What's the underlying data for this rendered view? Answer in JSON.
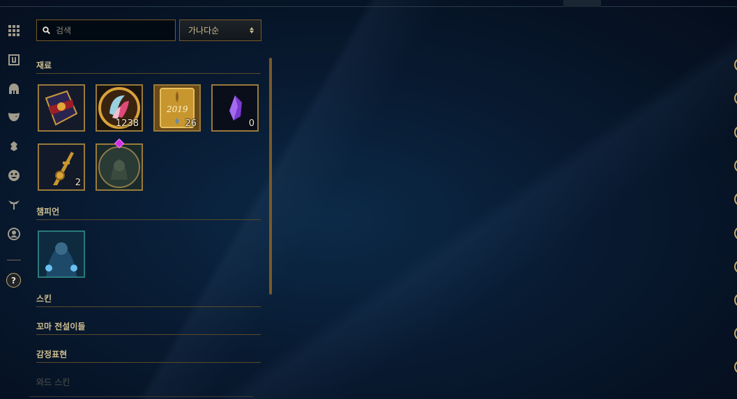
{
  "search": {
    "placeholder": "검색"
  },
  "sort": {
    "selected": "가나다순"
  },
  "sections": {
    "materials": {
      "title": "재료",
      "items": [
        {
          "name": "treasure-chest",
          "count": ""
        },
        {
          "name": "orange-essence",
          "count": "1238"
        },
        {
          "name": "2019-token",
          "count": "26",
          "tile_text": "2019"
        },
        {
          "name": "purple-gemstone",
          "count": "0"
        },
        {
          "name": "hextech-key",
          "count": "2"
        },
        {
          "name": "champion-icon-shard",
          "count": ""
        }
      ]
    },
    "champions": {
      "title": "챔피언",
      "items": [
        {
          "name": "champion-shard"
        }
      ]
    },
    "skins": {
      "title": "스킨"
    },
    "little_legends": {
      "title": "꼬마 전설이들"
    },
    "emotes": {
      "title": "감정표현"
    },
    "ward_skins": {
      "title": "와드 스킨"
    }
  },
  "rail": {
    "icons": [
      "grid-icon",
      "loot-icon",
      "helmet-icon",
      "mask-icon",
      "emote-icon",
      "face-icon",
      "ward-icon",
      "profile-icon",
      "help-icon"
    ]
  },
  "colors": {
    "gold": "#c8aa6e",
    "border_gold": "#785a28",
    "text_gold": "#cdbe91",
    "background": "#07101f"
  }
}
